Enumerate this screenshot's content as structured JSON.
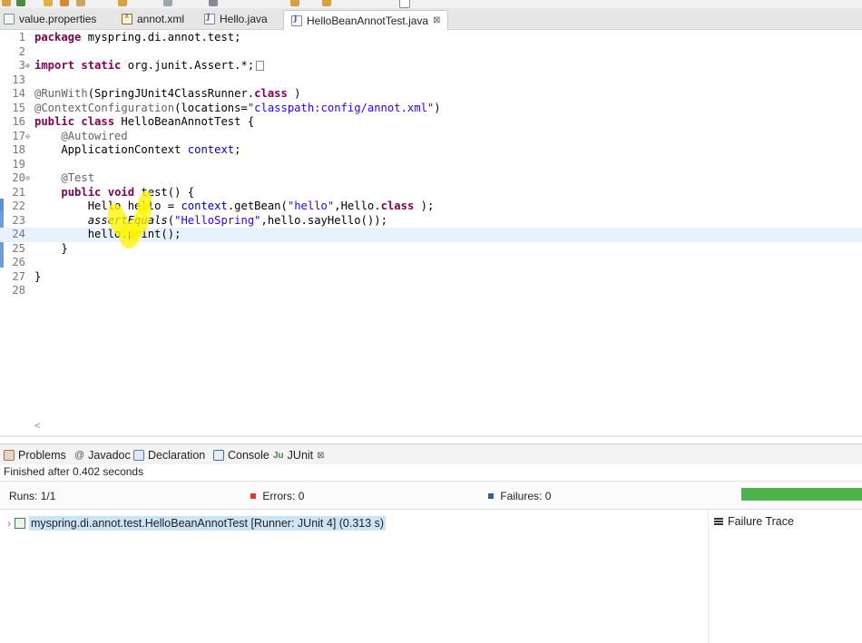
{
  "editor_tabs": [
    {
      "label": "value.properties",
      "icon": "properties-file-icon"
    },
    {
      "label": "annot.xml",
      "icon": "xml-file-icon"
    },
    {
      "label": "Hello.java",
      "icon": "java-file-icon"
    },
    {
      "label": "HelloBeanAnnotTest.java",
      "icon": "java-file-icon",
      "close": "⊠",
      "active": true
    }
  ],
  "code": {
    "lines": [
      {
        "n": "1",
        "t": [
          [
            "kw",
            "package"
          ],
          [
            "",
            "myspring.di.annot.test;"
          ]
        ]
      },
      {
        "n": "2",
        "t": []
      },
      {
        "n": "3",
        "fold": "⊕",
        "t": [
          [
            "kw",
            "import"
          ],
          [
            "",
            ""
          ],
          [
            "kw",
            "static"
          ],
          [
            "",
            "org.junit.Assert.*;"
          ]
        ]
      },
      {
        "n": "13",
        "t": []
      },
      {
        "n": "14",
        "t": [
          [
            "ann",
            "@RunWith"
          ],
          [
            "",
            "(SpringJUnit4ClassRunner."
          ],
          [
            "kw",
            "class"
          ],
          [
            "",
            ")"
          ]
        ]
      },
      {
        "n": "15",
        "t": [
          [
            "ann",
            "@ContextConfiguration"
          ],
          [
            "",
            "(locations="
          ],
          [
            "str",
            "\"classpath:config/annot.xml\""
          ],
          [
            "",
            ")"
          ]
        ]
      },
      {
        "n": "16",
        "t": [
          [
            "kw",
            "public"
          ],
          [
            "",
            ""
          ],
          [
            "kw",
            "class"
          ],
          [
            "",
            "HelloBeanAnnotTest {"
          ]
        ]
      },
      {
        "n": "17",
        "fold": "⊖",
        "t": [
          [
            "",
            "    "
          ],
          [
            "ann",
            "@Autowired"
          ]
        ]
      },
      {
        "n": "18",
        "t": [
          [
            "",
            "    ApplicationContext "
          ],
          [
            "fld",
            "context"
          ],
          [
            "",
            ";"
          ]
        ]
      },
      {
        "n": "19",
        "t": []
      },
      {
        "n": "20",
        "fold": "⊖",
        "t": [
          [
            "",
            "    "
          ],
          [
            "ann",
            "@Test"
          ]
        ]
      },
      {
        "n": "21",
        "t": [
          [
            "",
            "    "
          ],
          [
            "kw",
            "public"
          ],
          [
            "",
            ""
          ],
          [
            "kw",
            "void"
          ],
          [
            "",
            "test() {"
          ]
        ]
      },
      {
        "n": "22",
        "t": [
          [
            "",
            "        Hello hello = "
          ],
          [
            "fld",
            "context"
          ],
          [
            "",
            ".getBean("
          ],
          [
            "str",
            "\"hello\""
          ],
          [
            "",
            ",Hello."
          ],
          [
            "kw",
            "class"
          ],
          [
            "",
            ");"
          ]
        ]
      },
      {
        "n": "23",
        "t": [
          [
            "",
            "        "
          ],
          [
            "ital",
            "assertEquals"
          ],
          [
            "",
            "("
          ],
          [
            "str",
            "\"HelloSpring\""
          ],
          [
            "",
            ",hello.sayHello());"
          ]
        ]
      },
      {
        "n": "24",
        "current": true,
        "t": [
          [
            "",
            "        hello.print();"
          ]
        ]
      },
      {
        "n": "25",
        "t": [
          [
            "",
            "    }"
          ]
        ]
      },
      {
        "n": "26",
        "t": []
      },
      {
        "n": "27",
        "t": [
          [
            "",
            "}"
          ]
        ]
      },
      {
        "n": "28",
        "t": []
      }
    ],
    "scroll_left": "<"
  },
  "view_tabs": [
    {
      "label": "Problems",
      "icon": "problems-icon"
    },
    {
      "label": "Javadoc",
      "icon": "javadoc-icon"
    },
    {
      "label": "Declaration",
      "icon": "declaration-icon"
    },
    {
      "label": "Console",
      "icon": "console-icon"
    },
    {
      "label": "JUnit",
      "icon": "junit-icon",
      "close": "⊠",
      "active": true
    }
  ],
  "junit": {
    "status": "Finished after 0.402 seconds",
    "runs_label": "Runs:",
    "runs_value": "1/1",
    "errors_label": "Errors:",
    "errors_value": "0",
    "failures_label": "Failures:",
    "failures_value": "0",
    "progress_fraction": 1.0,
    "progress_color": "#4eb34e",
    "tree_expander": "›",
    "suite": "myspring.di.annot.test.HelloBeanAnnotTest [Runner: JUnit 4] (0.313 s)",
    "failure_trace": "Failure Trace"
  },
  "colors": {
    "keyword": "#7f0055",
    "annotation": "#646464",
    "string": "#2a00ff",
    "field": "#0000c0",
    "current_line": "#e8f2fe",
    "highlighter": "#fff500"
  }
}
